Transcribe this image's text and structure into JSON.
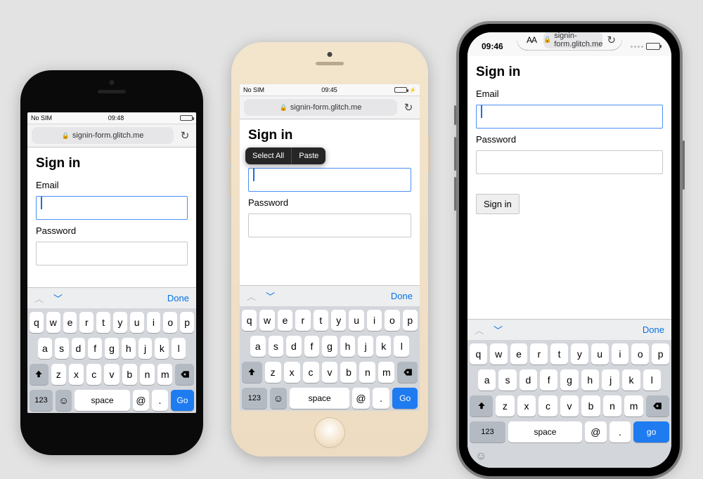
{
  "url_text": "signin-form.glitch.me",
  "page": {
    "heading": "Sign in",
    "email_label": "Email",
    "password_label": "Password",
    "signin_button": "Sign in"
  },
  "context_menu": {
    "select_all": "Select All",
    "paste": "Paste"
  },
  "kb_accessory": {
    "done": "Done"
  },
  "keyboard": {
    "row1": [
      "q",
      "w",
      "e",
      "r",
      "t",
      "y",
      "u",
      "i",
      "o",
      "p"
    ],
    "row2": [
      "a",
      "s",
      "d",
      "f",
      "g",
      "h",
      "j",
      "k",
      "l"
    ],
    "row3": [
      "z",
      "x",
      "c",
      "v",
      "b",
      "n",
      "m"
    ],
    "k123": "123",
    "space": "space",
    "at": "@",
    "dot": ".",
    "go1": "Go",
    "go2": "Go",
    "go3": "go"
  },
  "status": {
    "phone1": {
      "carrier": "No SIM",
      "time": "09:48"
    },
    "phone2": {
      "carrier": "No SIM",
      "time": "09:45"
    },
    "phone3": {
      "time": "09:46"
    }
  },
  "addr_aa": "AA"
}
